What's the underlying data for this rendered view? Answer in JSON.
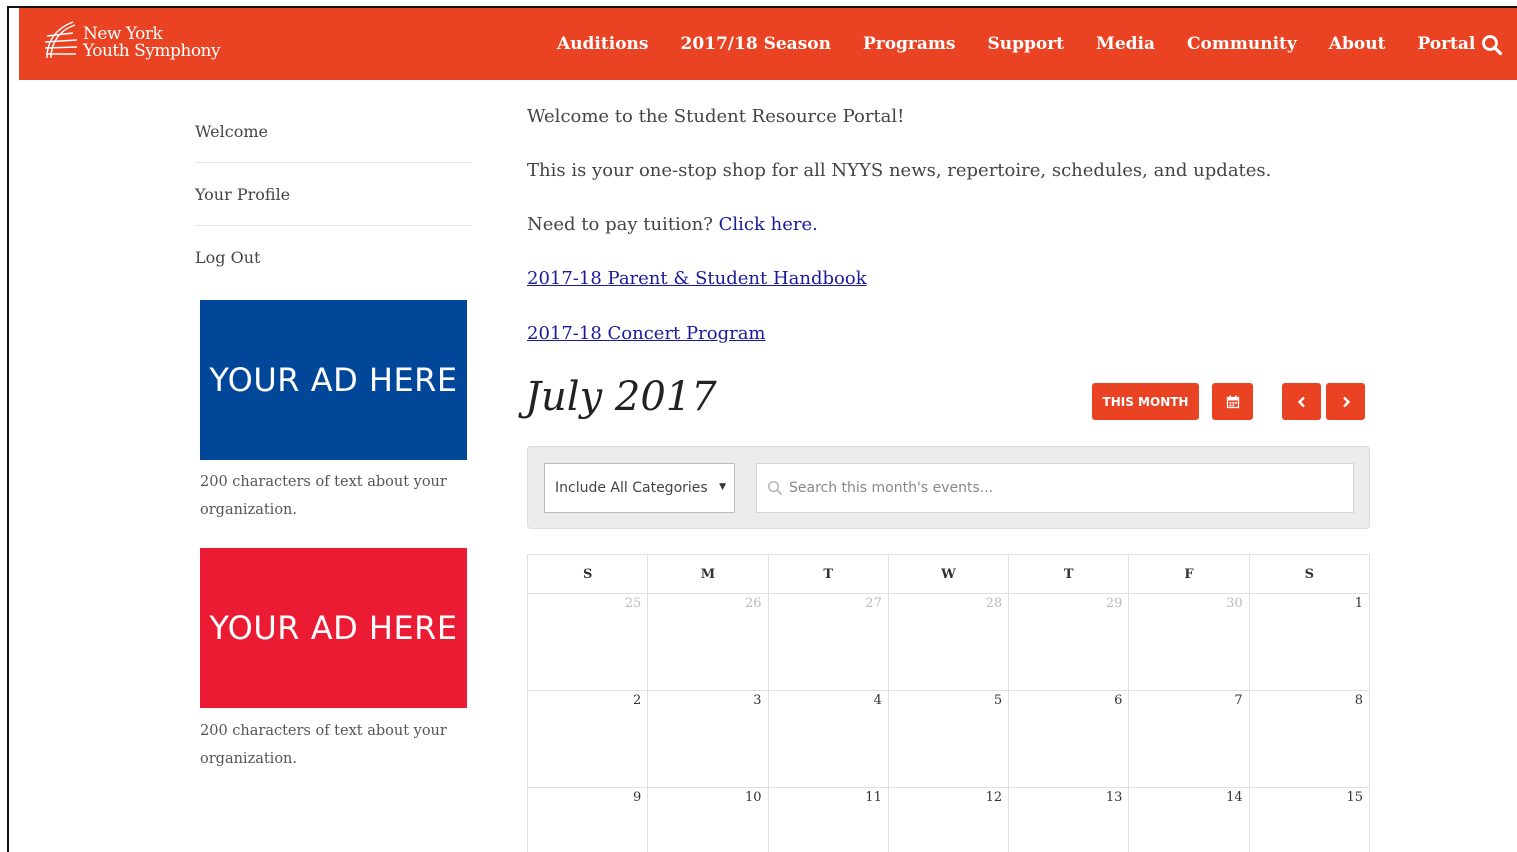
{
  "brand": {
    "line1": "New York",
    "line2": "Youth Symphony",
    "color": "#ea4324"
  },
  "nav": [
    "Auditions",
    "2017/18 Season",
    "Programs",
    "Support",
    "Media",
    "Community",
    "About",
    "Portal"
  ],
  "search_icon": "search-icon",
  "sidebar": {
    "items": [
      "Welcome",
      "Your Profile",
      "Log Out"
    ],
    "ads": [
      {
        "label": "YOUR AD HERE",
        "caption_line1": "200 characters of text about your",
        "caption_line2": "organization.",
        "color": "#00479a"
      },
      {
        "label": "YOUR AD HERE",
        "caption_line1": "200 characters of text about your",
        "caption_line2": "organization.",
        "color": "#ec1b34"
      }
    ]
  },
  "main": {
    "welcome": "Welcome to the Student Resource Portal!",
    "intro": "This is your one-stop shop for all NYYS news, repertoire, schedules, and updates.",
    "tuition_prefix": "Need to pay tuition? ",
    "tuition_link": "Click here.",
    "handbook_link": "2017-18 Parent & Student Handbook",
    "program_link": "2017-18 Concert Program "
  },
  "calendar": {
    "title": "July 2017",
    "this_month": "THIS MONTH",
    "category_select": "Include All Categories",
    "search_placeholder": "Search this month's events...",
    "weekdays": [
      "S",
      "M",
      "T",
      "W",
      "T",
      "F",
      "S"
    ],
    "weeks": [
      [
        "25",
        "26",
        "27",
        "28",
        "29",
        "30",
        "1"
      ],
      [
        "2",
        "3",
        "4",
        "5",
        "6",
        "7",
        "8"
      ],
      [
        "9",
        "10",
        "11",
        "12",
        "13",
        "14",
        "15"
      ]
    ]
  }
}
